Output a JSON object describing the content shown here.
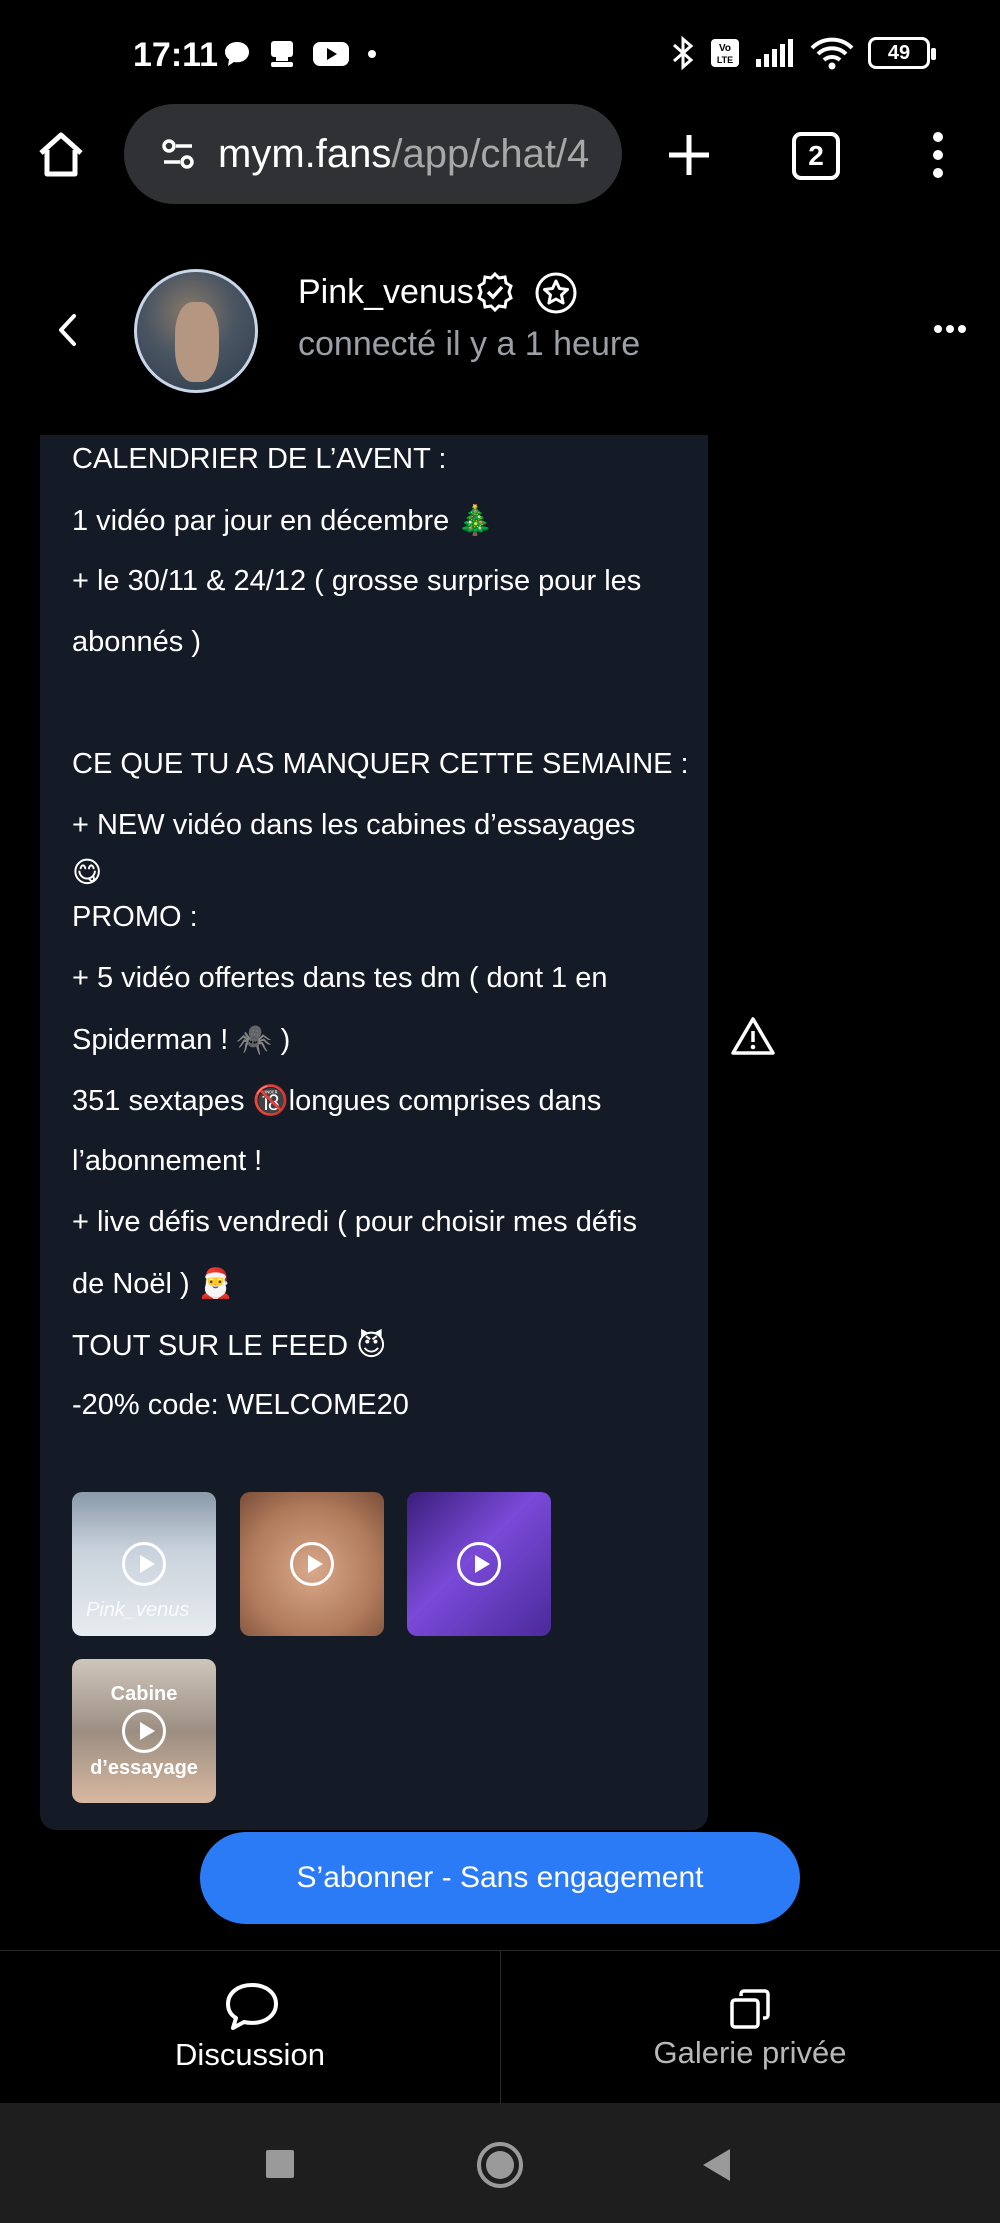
{
  "status_bar": {
    "time": "17:11",
    "battery": "49",
    "icons_left": [
      "chat-bubble-icon",
      "notification-icon",
      "youtube-icon",
      "dot-icon"
    ],
    "icons_right": [
      "bluetooth-icon",
      "volte-icon",
      "signal-icon",
      "wifi-icon",
      "battery-icon"
    ]
  },
  "browser": {
    "url_host": "mym.fans",
    "url_path": "/app/chat/4",
    "tabs_count": "2"
  },
  "chat": {
    "username": "Pink_venus",
    "presence": "connecté il y a 1 heure"
  },
  "message": {
    "lines": [
      "CALENDRIER DE L’AVENT :",
      "1 vidéo par jour en décembre 🎄",
      "+ le 30/11 & 24/12 ( grosse surprise pour les",
      "abonnés )",
      "CE QUE TU AS MANQUER CETTE SEMAINE :",
      "+ NEW vidéo dans les cabines d’essayages",
      "😋",
      "PROMO :",
      "+ 5 vidéo offertes dans tes dm ( dont 1 en",
      "Spiderman ! 🕷️ )",
      "351 sextapes 🔞longues comprises dans",
      "l’abonnement !",
      "+ live défis vendredi ( pour choisir mes défis",
      "de Noël ) 🎅",
      "TOUT SUR LE FEED 😈",
      "-20% code: WELCOME20"
    ],
    "thumbnails": [
      {
        "watermark": "Pink_venus"
      },
      {
        "watermark": ""
      },
      {
        "watermark": ""
      },
      {
        "caption_top": "Cabine",
        "caption_bottom": "d’essayage"
      }
    ]
  },
  "cta": {
    "subscribe_label": "S’abonner - Sans engagement"
  },
  "bottom_nav": {
    "discussion": "Discussion",
    "gallery": "Galerie privée"
  },
  "colors": {
    "background": "#000000",
    "bubble": "#151b26",
    "accent": "#2b7bf7",
    "muted_text": "#9aa0a6"
  }
}
